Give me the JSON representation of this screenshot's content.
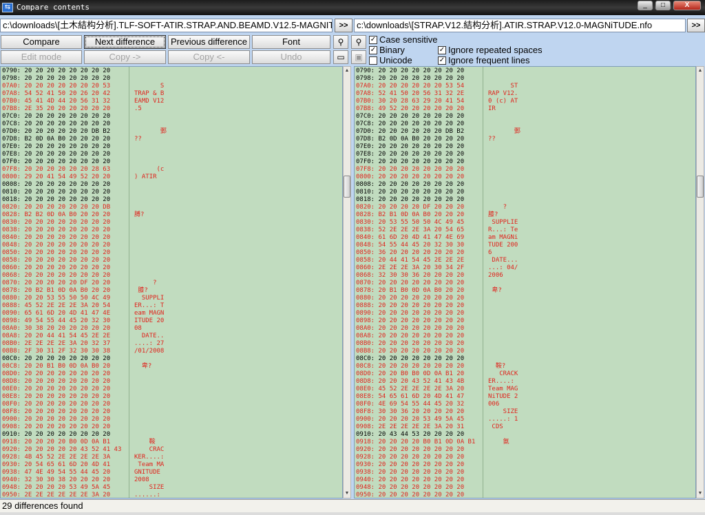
{
  "window": {
    "title": "Compare contents",
    "icon": "compare-arrows-icon",
    "controls": {
      "minimize": "_",
      "maximize": "□",
      "close": "X"
    }
  },
  "left_file": {
    "path": "c:\\downloads\\[土木結构分析].TLF-SOFT-ATIR.STRAP.AND.BEAMD.V12.5-MAGNITUDE.nfo",
    "browse_label": ">>"
  },
  "right_file": {
    "path": "c:\\downloads\\[STRAP.V12.結构分析].ATIR.STRAP.V12.0-MAGNiTUDE.nfo",
    "browse_label": ">>"
  },
  "toolbar": {
    "compare": "Compare",
    "next_difference": "Next difference",
    "previous_difference": "Previous difference",
    "font": "Font",
    "edit_mode": "Edit mode",
    "copy_right": "Copy ->",
    "copy_left": "Copy <-",
    "undo": "Undo",
    "search_icon": "binoculars-icon",
    "search_next_icon": "binoculars-next-icon",
    "save_icon": "save-disk-icon",
    "window_icon": "window-icon"
  },
  "options": {
    "case_sensitive": {
      "label": "Case sensitive",
      "checked": true
    },
    "binary": {
      "label": "Binary",
      "checked": true
    },
    "unicode": {
      "label": "Unicode",
      "checked": false
    },
    "ignore_repeated_spaces": {
      "label": "Ignore repeated spaces",
      "checked": true
    },
    "ignore_frequent_lines": {
      "label": "Ignore frequent lines",
      "checked": true
    }
  },
  "left_pane": {
    "lines": [
      {
        "hex": "0790: 20 20 20 20 20 20 20 20",
        "ascii": "",
        "diff": false
      },
      {
        "hex": "0798: 20 20 20 20 20 20 20 20",
        "ascii": "",
        "diff": false
      },
      {
        "hex": "07A0: 20 20 20 20 20 20 20 53",
        "ascii": "       S",
        "diff": true
      },
      {
        "hex": "07A8: 54 52 41 50 20 26 20 42",
        "ascii": "TRAP & B",
        "diff": true
      },
      {
        "hex": "07B0: 45 41 4D 44 20 56 31 32",
        "ascii": "EAMD V12",
        "diff": true
      },
      {
        "hex": "07B8: 2E 35 20 20 20 20 20 20",
        "ascii": ".5",
        "diff": true
      },
      {
        "hex": "07C0: 20 20 20 20 20 20 20 20",
        "ascii": "",
        "diff": false
      },
      {
        "hex": "07C8: 20 20 20 20 20 20 20 20",
        "ascii": "",
        "diff": false
      },
      {
        "hex": "07D0: 20 20 20 20 20 20 DB B2",
        "ascii": "       鄄",
        "diff": false
      },
      {
        "hex": "07D8: B2 0D 0A B0 20 20 20 20",
        "ascii": "??",
        "diff": false
      },
      {
        "hex": "07E0: 20 20 20 20 20 20 20 20",
        "ascii": "",
        "diff": false
      },
      {
        "hex": "07E8: 20 20 20 20 20 20 20 20",
        "ascii": "",
        "diff": false
      },
      {
        "hex": "07F0: 20 20 20 20 20 20 20 20",
        "ascii": "",
        "diff": false
      },
      {
        "hex": "07F8: 20 20 20 20 20 20 28 63",
        "ascii": "      (c",
        "diff": true
      },
      {
        "hex": "0800: 29 20 41 54 49 52 20 20",
        "ascii": ") ATIR",
        "diff": true
      },
      {
        "hex": "0808: 20 20 20 20 20 20 20 20",
        "ascii": "",
        "diff": false
      },
      {
        "hex": "0810: 20 20 20 20 20 20 20 20",
        "ascii": "",
        "diff": false
      },
      {
        "hex": "0818: 20 20 20 20 20 20 20 20",
        "ascii": "",
        "diff": false
      },
      {
        "hex": "0820: 20 20 20 20 20 20 20 DB",
        "ascii": "",
        "diff": true
      },
      {
        "hex": "0828: B2 B2 0D 0A B0 20 20 20",
        "ascii": "膊?",
        "diff": true
      },
      {
        "hex": "0830: 20 20 20 20 20 20 20 20",
        "ascii": "",
        "diff": true
      },
      {
        "hex": "0838: 20 20 20 20 20 20 20 20",
        "ascii": "",
        "diff": true
      },
      {
        "hex": "0840: 20 20 20 20 20 20 20 20",
        "ascii": "",
        "diff": true
      },
      {
        "hex": "0848: 20 20 20 20 20 20 20 20",
        "ascii": "",
        "diff": true
      },
      {
        "hex": "0850: 20 20 20 20 20 20 20 20",
        "ascii": "",
        "diff": true
      },
      {
        "hex": "0858: 20 20 20 20 20 20 20 20",
        "ascii": "",
        "diff": true
      },
      {
        "hex": "0860: 20 20 20 20 20 20 20 20",
        "ascii": "",
        "diff": true
      },
      {
        "hex": "0868: 20 20 20 20 20 20 20 20",
        "ascii": "",
        "diff": true
      },
      {
        "hex": "0870: 20 20 20 20 20 DF 20 20",
        "ascii": "     ?",
        "diff": true
      },
      {
        "hex": "0878: 20 B2 B1 0D 0A B0 20 20",
        "ascii": " 膝?",
        "diff": true
      },
      {
        "hex": "0880: 20 20 53 55 50 50 4C 49",
        "ascii": "  SUPPLI",
        "diff": true
      },
      {
        "hex": "0888: 45 52 2E 2E 2E 3A 20 54",
        "ascii": "ER...: T",
        "diff": true
      },
      {
        "hex": "0890: 65 61 6D 20 4D 41 47 4E",
        "ascii": "eam MAGN",
        "diff": true
      },
      {
        "hex": "0898: 49 54 55 44 45 20 32 30",
        "ascii": "ITUDE 20",
        "diff": true
      },
      {
        "hex": "08A0: 30 38 20 20 20 20 20 20",
        "ascii": "08",
        "diff": true
      },
      {
        "hex": "08A8: 20 20 44 41 54 45 2E 2E",
        "ascii": "  DATE..",
        "diff": true
      },
      {
        "hex": "08B0: 2E 2E 2E 2E 3A 20 32 37",
        "ascii": "....: 27",
        "diff": true
      },
      {
        "hex": "08B8: 2F 30 31 2F 32 30 30 38",
        "ascii": "/01/2008",
        "diff": true
      },
      {
        "hex": "08C0: 20 20 20 20 20 20 20 20",
        "ascii": "",
        "diff": false
      },
      {
        "hex": "08C8: 20 20 B1 B0 0D 0A B0 20",
        "ascii": "  卑?",
        "diff": true
      },
      {
        "hex": "08D0: 20 20 20 20 20 20 20 20",
        "ascii": "",
        "diff": true
      },
      {
        "hex": "08D8: 20 20 20 20 20 20 20 20",
        "ascii": "",
        "diff": true
      },
      {
        "hex": "08E0: 20 20 20 20 20 20 20 20",
        "ascii": "",
        "diff": true
      },
      {
        "hex": "08E8: 20 20 20 20 20 20 20 20",
        "ascii": "",
        "diff": true
      },
      {
        "hex": "08F0: 20 20 20 20 20 20 20 20",
        "ascii": "",
        "diff": true
      },
      {
        "hex": "08F8: 20 20 20 20 20 20 20 20",
        "ascii": "",
        "diff": true
      },
      {
        "hex": "0900: 20 20 20 20 20 20 20 20",
        "ascii": "",
        "diff": true
      },
      {
        "hex": "0908: 20 20 20 20 20 20 20 20",
        "ascii": "",
        "diff": true
      },
      {
        "hex": "0910: 20 20 20 20 20 20 20 20",
        "ascii": "",
        "diff": false
      },
      {
        "hex": "0918: 20 20 20 20 B0 0D 0A B1",
        "ascii": "    鞍",
        "diff": true
      },
      {
        "hex": "0920: 20 20 20 20 20 43 52 41 43",
        "ascii": "    CRAC",
        "diff": true
      },
      {
        "hex": "0928: 4B 45 52 2E 2E 2E 2E 3A",
        "ascii": "KER....:",
        "diff": true
      },
      {
        "hex": "0930: 20 54 65 61 6D 20 4D 41",
        "ascii": " Team MA",
        "diff": true
      },
      {
        "hex": "0938: 47 4E 49 54 55 44 45 20",
        "ascii": "GNITUDE",
        "diff": true
      },
      {
        "hex": "0940: 32 30 30 38 20 20 20 20",
        "ascii": "2008",
        "diff": true
      },
      {
        "hex": "0948: 20 20 20 20 53 49 5A 45",
        "ascii": "    SIZE",
        "diff": true
      },
      {
        "hex": "0950: 2E 2E 2E 2E 2E 2E 3A 20",
        "ascii": "......:",
        "diff": true
      }
    ]
  },
  "right_pane": {
    "lines": [
      {
        "hex": "0790: 20 20 20 20 20 20 20 20",
        "ascii": "",
        "diff": false
      },
      {
        "hex": "0798: 20 20 20 20 20 20 20 20",
        "ascii": "",
        "diff": false
      },
      {
        "hex": "07A0: 20 20 20 20 20 20 53 54",
        "ascii": "      ST",
        "diff": true
      },
      {
        "hex": "07A8: 52 41 50 20 56 31 32 2E",
        "ascii": "RAP V12.",
        "diff": true
      },
      {
        "hex": "07B0: 30 20 28 63 29 20 41 54",
        "ascii": "0 (c) AT",
        "diff": true
      },
      {
        "hex": "07B8: 49 52 20 20 20 20 20 20",
        "ascii": "IR",
        "diff": true
      },
      {
        "hex": "07C0: 20 20 20 20 20 20 20 20",
        "ascii": "",
        "diff": false
      },
      {
        "hex": "07C8: 20 20 20 20 20 20 20 20",
        "ascii": "",
        "diff": false
      },
      {
        "hex": "07D0: 20 20 20 20 20 20 DB B2",
        "ascii": "       鄄",
        "diff": false
      },
      {
        "hex": "07D8: B2 0D 0A B0 20 20 20 20",
        "ascii": "??",
        "diff": false
      },
      {
        "hex": "07E0: 20 20 20 20 20 20 20 20",
        "ascii": "",
        "diff": false
      },
      {
        "hex": "07E8: 20 20 20 20 20 20 20 20",
        "ascii": "",
        "diff": false
      },
      {
        "hex": "07F0: 20 20 20 20 20 20 20 20",
        "ascii": "",
        "diff": false
      },
      {
        "hex": "07F8: 20 20 20 20 20 20 20 20",
        "ascii": "",
        "diff": true
      },
      {
        "hex": "0800: 20 20 20 20 20 20 20 20",
        "ascii": "",
        "diff": true
      },
      {
        "hex": "0808: 20 20 20 20 20 20 20 20",
        "ascii": "",
        "diff": false
      },
      {
        "hex": "0810: 20 20 20 20 20 20 20 20",
        "ascii": "",
        "diff": false
      },
      {
        "hex": "0818: 20 20 20 20 20 20 20 20",
        "ascii": "",
        "diff": false
      },
      {
        "hex": "0820: 20 20 20 20 DF 20 20 20",
        "ascii": "    ?",
        "diff": true
      },
      {
        "hex": "0828: B2 B1 0D 0A B0 20 20 20",
        "ascii": "膝?",
        "diff": true
      },
      {
        "hex": "0830: 20 53 55 50 50 4C 49 45",
        "ascii": " SUPPLIE",
        "diff": true
      },
      {
        "hex": "0838: 52 2E 2E 2E 3A 20 54 65",
        "ascii": "R...: Te",
        "diff": true
      },
      {
        "hex": "0840: 61 6D 20 4D 41 47 4E 69",
        "ascii": "am MAGNi",
        "diff": true
      },
      {
        "hex": "0848: 54 55 44 45 20 32 30 30",
        "ascii": "TUDE 200",
        "diff": true
      },
      {
        "hex": "0850: 36 20 20 20 20 20 20 20",
        "ascii": "6",
        "diff": true
      },
      {
        "hex": "0858: 20 44 41 54 45 2E 2E 2E",
        "ascii": " DATE...",
        "diff": true
      },
      {
        "hex": "0860: 2E 2E 2E 3A 20 30 34 2F",
        "ascii": "...: 04/",
        "diff": true
      },
      {
        "hex": "0868: 32 30 30 36 20 20 20 20",
        "ascii": "2006",
        "diff": true
      },
      {
        "hex": "0870: 20 20 20 20 20 20 20 20",
        "ascii": "",
        "diff": true
      },
      {
        "hex": "0878: 20 B1 B0 0D 0A B0 20 20",
        "ascii": " 卑?",
        "diff": true
      },
      {
        "hex": "0880: 20 20 20 20 20 20 20 20",
        "ascii": "",
        "diff": true
      },
      {
        "hex": "0888: 20 20 20 20 20 20 20 20",
        "ascii": "",
        "diff": true
      },
      {
        "hex": "0890: 20 20 20 20 20 20 20 20",
        "ascii": "",
        "diff": true
      },
      {
        "hex": "0898: 20 20 20 20 20 20 20 20",
        "ascii": "",
        "diff": true
      },
      {
        "hex": "08A0: 20 20 20 20 20 20 20 20",
        "ascii": "",
        "diff": true
      },
      {
        "hex": "08A8: 20 20 20 20 20 20 20 20",
        "ascii": "",
        "diff": true
      },
      {
        "hex": "08B0: 20 20 20 20 20 20 20 20",
        "ascii": "",
        "diff": true
      },
      {
        "hex": "08B8: 20 20 20 20 20 20 20 20",
        "ascii": "",
        "diff": true
      },
      {
        "hex": "08C0: 20 20 20 20 20 20 20 20",
        "ascii": "",
        "diff": false
      },
      {
        "hex": "08C8: 20 20 20 20 20 20 20 20",
        "ascii": "  鞍?",
        "diff": true
      },
      {
        "hex": "08D0: 20 20 B0 B0 0D 0A B1 20",
        "ascii": "   CRACK",
        "diff": true
      },
      {
        "hex": "08D8: 20 20 20 43 52 41 43 4B",
        "ascii": "ER....:",
        "diff": true
      },
      {
        "hex": "08E0: 45 52 2E 2E 2E 2E 3A 20",
        "ascii": "Team MAG",
        "diff": true
      },
      {
        "hex": "08E8: 54 65 61 6D 20 4D 41 47",
        "ascii": "NiTUDE 2",
        "diff": true
      },
      {
        "hex": "08F0: 4E 69 54 55 44 45 20 32",
        "ascii": "006",
        "diff": true
      },
      {
        "hex": "08F8: 30 30 36 20 20 20 20 20",
        "ascii": "    SIZE",
        "diff": true
      },
      {
        "hex": "0900: 20 20 20 20 53 49 5A 45",
        "ascii": ".....: 1",
        "diff": true
      },
      {
        "hex": "0908: 2E 2E 2E 2E 2E 3A 20 31",
        "ascii": " CDS",
        "diff": true
      },
      {
        "hex": "0910: 20 43 44 53 20 20 20 20",
        "ascii": "",
        "diff": false
      },
      {
        "hex": "0918: 20 20 20 20 B0 B1 0D 0A B1",
        "ascii": "    氨",
        "diff": true
      },
      {
        "hex": "0920: 20 20 20 20 20 20 20 20",
        "ascii": "",
        "diff": true
      },
      {
        "hex": "0928: 20 20 20 20 20 20 20 20",
        "ascii": "",
        "diff": true
      },
      {
        "hex": "0930: 20 20 20 20 20 20 20 20",
        "ascii": "",
        "diff": true
      },
      {
        "hex": "0938: 20 20 20 20 20 20 20 20",
        "ascii": "",
        "diff": true
      },
      {
        "hex": "0940: 20 20 20 20 20 20 20 20",
        "ascii": "",
        "diff": true
      },
      {
        "hex": "0948: 20 20 20 20 20 20 20 20",
        "ascii": "",
        "diff": true
      },
      {
        "hex": "0950: 20 20 20 20 20 20 20 20",
        "ascii": "",
        "diff": true
      }
    ]
  },
  "status": {
    "text": "29 differences found"
  },
  "colors": {
    "diff_text": "#e0231c",
    "pane_bg": "#c1dcbf",
    "window_bg": "#bfd5f0"
  }
}
